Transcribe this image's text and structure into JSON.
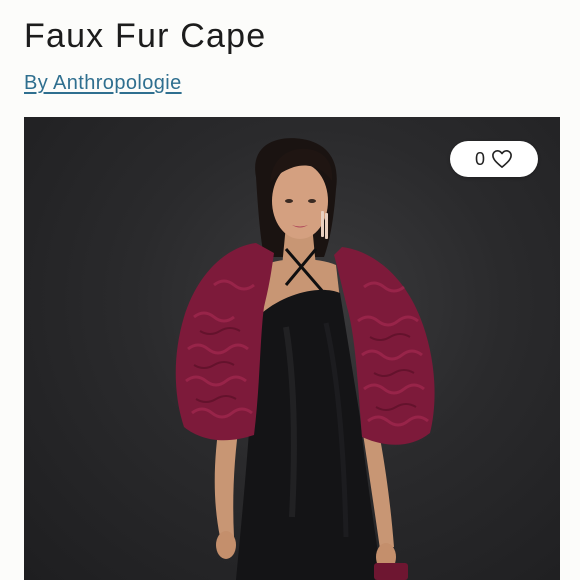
{
  "product": {
    "title": "Faux Fur Cape",
    "brand_link": "By Anthropologie"
  },
  "like": {
    "count": "0",
    "icon": "heart-outline-icon"
  },
  "colors": {
    "brand_link": "#2f6f8f",
    "photo_background": "#2a2a2c",
    "cape": "#7d1a3a",
    "dress": "#141416"
  }
}
